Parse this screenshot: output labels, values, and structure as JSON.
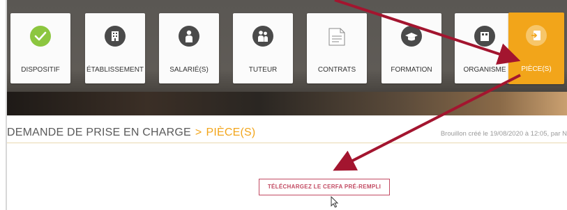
{
  "tiles": [
    {
      "label": "DISPOSITIF",
      "icon": "check-icon"
    },
    {
      "label": "ÉTABLISSEMENT",
      "icon": "building-icon"
    },
    {
      "label": "SALARIÉ(S)",
      "icon": "person-icon"
    },
    {
      "label": "TUTEUR",
      "icon": "people-icon"
    },
    {
      "label": "CONTRATS",
      "icon": "document-icon"
    },
    {
      "label": "FORMATION",
      "icon": "graduation-cap-icon"
    },
    {
      "label": "ORGANISME",
      "icon": "organization-icon"
    },
    {
      "label": "PIÈCE(S)",
      "icon": "file-import-icon"
    }
  ],
  "breadcrumb": {
    "parent": "DEMANDE DE PRISE EN CHARGE",
    "separator": ">",
    "current": "PIÈCE(S)"
  },
  "status": "Brouillon créé le 19/08/2020 à 12:05, par N",
  "cerfa_button": "TÉLÉCHARGEZ LE CERFA PRÉ-REMPLI",
  "colors": {
    "accent": "#f2a51a",
    "check": "#8cc63f",
    "annotation_arrow": "#a3152f",
    "button_border": "#c24a62"
  }
}
